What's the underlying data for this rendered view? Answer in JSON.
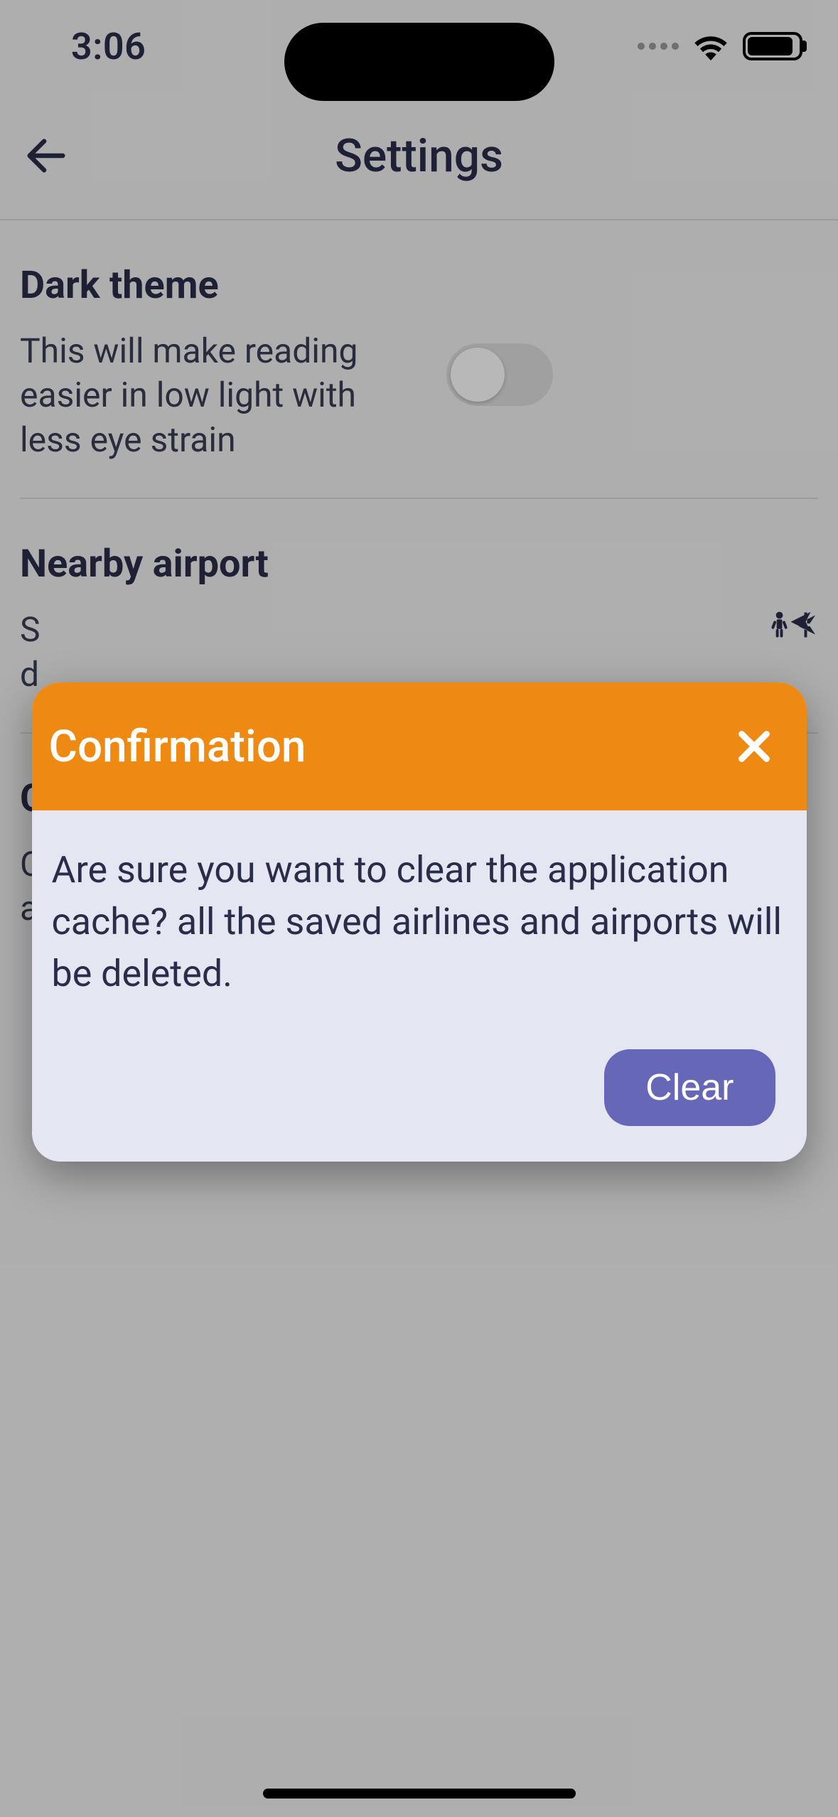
{
  "status": {
    "time": "3:06"
  },
  "nav": {
    "title": "Settings"
  },
  "sections": {
    "dark_theme": {
      "title": "Dark theme",
      "desc": "This will make reading easier in low light with less eye strain",
      "enabled": false
    },
    "nearby_airport": {
      "title": "Nearby airport",
      "desc_partial_visible": "S\nd"
    },
    "cache": {
      "title_partial_visible": "C",
      "desc_partial_visible": "C\na"
    }
  },
  "modal": {
    "title": "Confirmation",
    "message": "Are sure you want to clear the application cache? all the saved airlines and airports will be deleted.",
    "clear_label": "Clear"
  }
}
